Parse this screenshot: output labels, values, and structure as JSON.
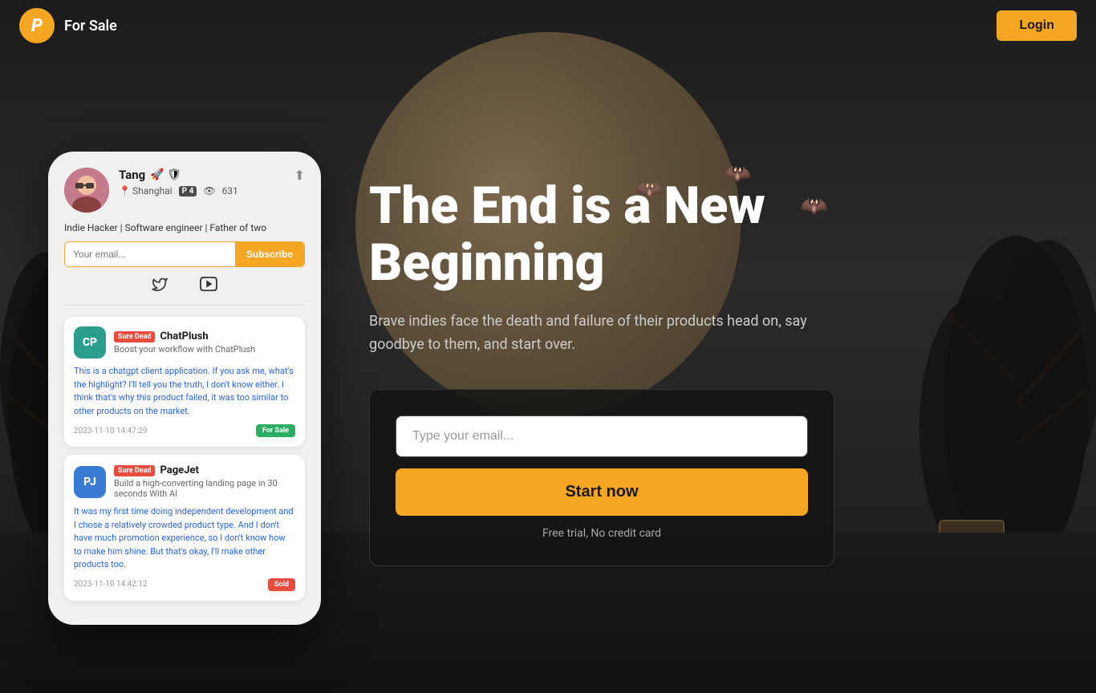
{
  "navbar": {
    "logo_letter": "P",
    "title": "For Sale",
    "login_label": "Login"
  },
  "hero": {
    "title_line1": "The End is a New",
    "title_line2": "Beginning",
    "subtitle": "Brave indies face the death and failure of their products head on, say goodbye to them, and start over.",
    "email_placeholder": "Type your email...",
    "cta_button": "Start now",
    "free_trial_text": "Free trial, No credit card"
  },
  "profile": {
    "name": "Tang",
    "emojis": "🚀 🛡",
    "location": "Shanghai",
    "posts": "4",
    "views": "631",
    "bio": "Indie Hacker | Software engineer | Father of two",
    "email_placeholder": "Your email...",
    "subscribe_label": "Subscribe"
  },
  "products": [
    {
      "logo_text": "CP",
      "logo_class": "product-logo-cp",
      "status_badge": "Sure Dead",
      "name": "ChatPlush",
      "tagline": "Boost your workflow with ChatPlush",
      "description": "This is a chatgpt client application. If you ask me, what's the highlight? I'll tell you the truth, I don't know either. I think that's why this product failed, it was too similar to other products on the market.",
      "timestamp": "2023-11-10 14:47:29",
      "badge": "For Sale",
      "badge_class": "for-sale-badge"
    },
    {
      "logo_text": "PJ",
      "logo_class": "product-logo-pj",
      "status_badge": "Sure Dead",
      "name": "PageJet",
      "tagline": "Build a high-converting landing page in 30 seconds With AI",
      "description": "It was my first time doing independent development and I chose a relatively crowded product type. And I don't have much promotion experience, so I don't know how to make him shine. But that's okay, I'll make other products too.",
      "timestamp": "2023-11-10 14:42:12",
      "badge": "Sold",
      "badge_class": "sold-badge"
    }
  ]
}
